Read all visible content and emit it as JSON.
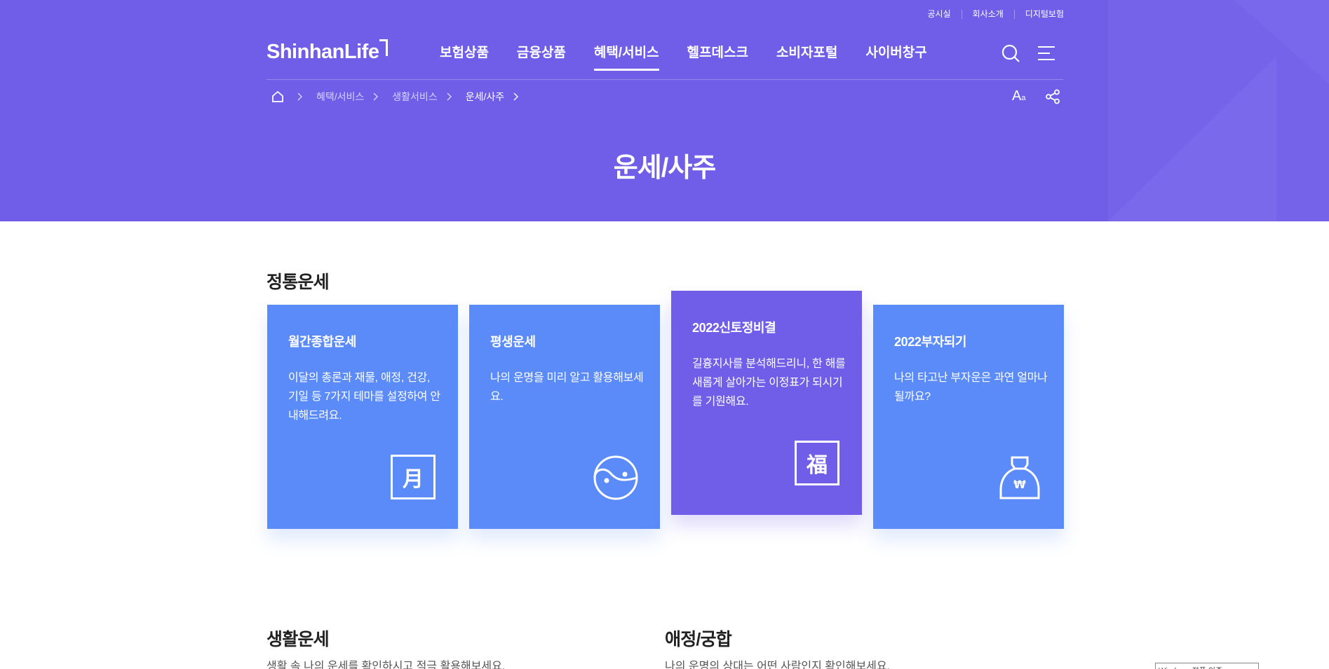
{
  "utility_links": [
    "공시실",
    "회사소개",
    "디지털보험"
  ],
  "logo": {
    "text": "ShinhanLife"
  },
  "gnb": [
    {
      "label": "보험상품",
      "active": false
    },
    {
      "label": "금융상품",
      "active": false
    },
    {
      "label": "혜택/서비스",
      "active": true
    },
    {
      "label": "헬프데스크",
      "active": false
    },
    {
      "label": "소비자포털",
      "active": false
    },
    {
      "label": "사이버창구",
      "active": false
    }
  ],
  "breadcrumb": [
    "혜택/서비스",
    "생활서비스",
    "운세/사주"
  ],
  "font_size_button": {
    "big": "A",
    "small": "a"
  },
  "page_title": "운세/사주",
  "sections": {
    "traditional": {
      "title": "정통운세",
      "cards": [
        {
          "title": "월간종합운세",
          "text": "이달의 총론과 재물, 애정, 건강, 기일 등 7가지 테마를 설정하여 안내해드려요.",
          "icon": "moon-character-icon",
          "glyph": "月",
          "featured": false
        },
        {
          "title": "평생운세",
          "text": "나의 운명을 미리 알고 활용해보세요.",
          "icon": "yin-yang-icon",
          "featured": false
        },
        {
          "title": "2022신토정비결",
          "text": "길흉지사를 분석해드리니, 한 해를 새롭게 살아가는 이정표가 되시기를 기원해요.",
          "icon": "fortune-character-icon",
          "glyph": "福",
          "featured": true
        },
        {
          "title": "2022부자되기",
          "text": "나의 타고난 부자운은 과연 얼마나 될까요?",
          "icon": "money-bag-icon",
          "glyph": "₩",
          "featured": false
        }
      ]
    },
    "life": {
      "title": "생활운세",
      "desc": "생활 속 나의 운세를 확인하시고 적극 활용해보세요."
    },
    "love": {
      "title": "애정/궁합",
      "desc": "나의 운명의 상대는 어떤 사람인지 확인해보세요."
    }
  },
  "colors": {
    "hero": "#705EE8",
    "card": "#5A8BF8",
    "card_featured": "#705EE8"
  },
  "watermark": "Windows 정품 인증"
}
